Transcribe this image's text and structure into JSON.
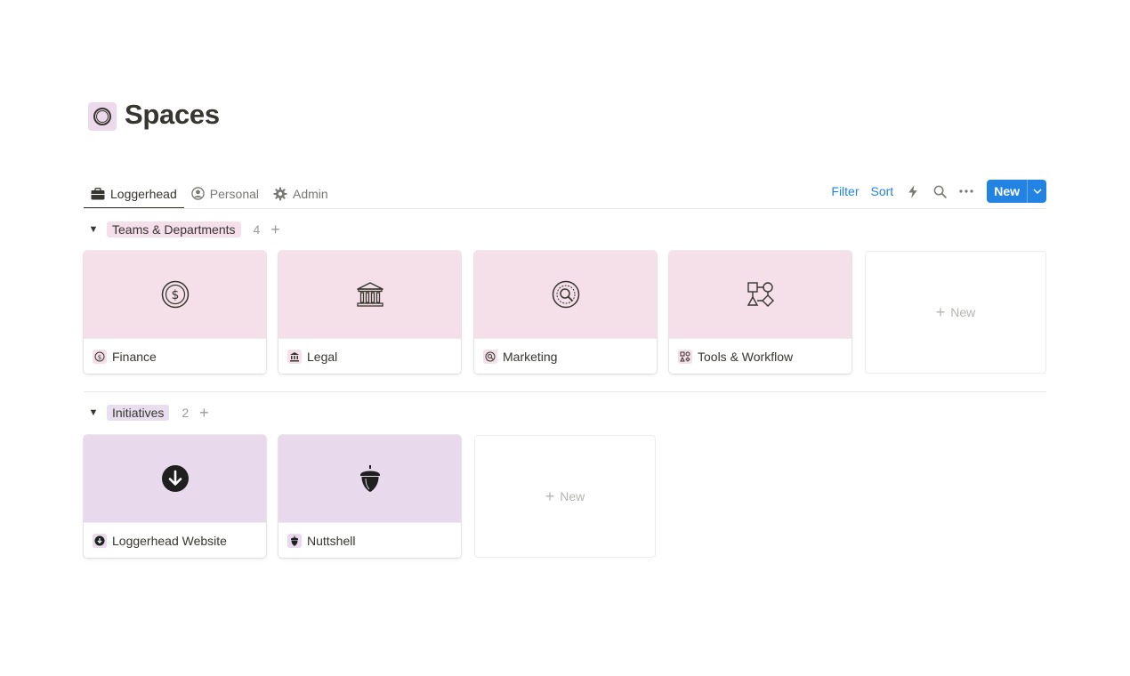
{
  "page": {
    "title": "Spaces",
    "icon": "circle-ring-icon",
    "icon_bg": "#ecd9ec"
  },
  "tabs": [
    {
      "label": "Loggerhead",
      "icon": "briefcase-icon",
      "active": true
    },
    {
      "label": "Personal",
      "icon": "person-circle-icon",
      "active": false
    },
    {
      "label": "Admin",
      "icon": "gear-icon",
      "active": false
    }
  ],
  "toolbar": {
    "filter_label": "Filter",
    "sort_label": "Sort",
    "icons": [
      "lightning-icon",
      "search-icon",
      "more-icon"
    ],
    "new_label": "New",
    "accent": "#2383e2"
  },
  "groups": [
    {
      "label": "Teams & Departments",
      "count": "4",
      "tag_color": "#f4dfeb",
      "cover_color": "#f5e0e9",
      "cards": [
        {
          "title": "Finance",
          "icon": "dollar-coin-icon"
        },
        {
          "title": "Legal",
          "icon": "bank-building-icon"
        },
        {
          "title": "Marketing",
          "icon": "magnifier-target-icon"
        },
        {
          "title": "Tools & Workflow",
          "icon": "flowchart-icon"
        }
      ],
      "new_label": "New"
    },
    {
      "label": "Initiatives",
      "count": "2",
      "tag_color": "#e8deee",
      "cover_color": "#e8d9ec",
      "cards": [
        {
          "title": "Loggerhead Website",
          "icon": "download-circle-icon"
        },
        {
          "title": "Nuttshell",
          "icon": "acorn-icon"
        }
      ],
      "new_label": "New"
    }
  ]
}
